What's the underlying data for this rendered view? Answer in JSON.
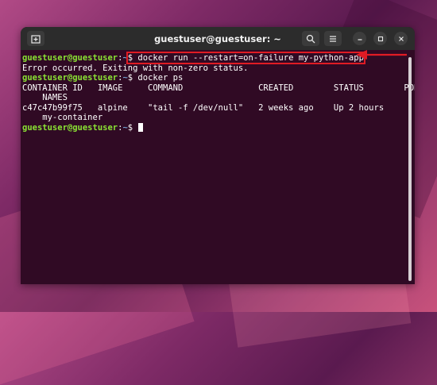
{
  "window": {
    "title": "guestuser@guestuser: ~"
  },
  "prompt": {
    "user": "guestuser@guestuser",
    "sep": ":",
    "path": "~",
    "symbol": "$ "
  },
  "lines": {
    "l1_cmd": "docker run --restart=on-failure my-python-app",
    "l2": "Error occurred. Exiting with non-zero status.",
    "l3_cmd": "docker ps",
    "l4": "CONTAINER ID   IMAGE     COMMAND               CREATED        STATUS        PORTS",
    "l5": "    NAMES",
    "l6": "c47c47b99f75   alpine    \"tail -f /dev/null\"   2 weeks ago    Up 2 hours",
    "l7": "    my-container"
  },
  "icons": {
    "new_tab": "new-tab-icon",
    "search": "search-icon",
    "menu": "hamburger-menu-icon",
    "minimize": "minimize-icon",
    "maximize": "maximize-icon",
    "close": "close-icon",
    "annotation": "arrow-left-icon"
  },
  "colors": {
    "terminal_bg": "#300a24",
    "prompt_user": "#8ae234",
    "prompt_path": "#729fcf",
    "highlight": "#e01b24",
    "titlebar": "#2c2c2c"
  }
}
